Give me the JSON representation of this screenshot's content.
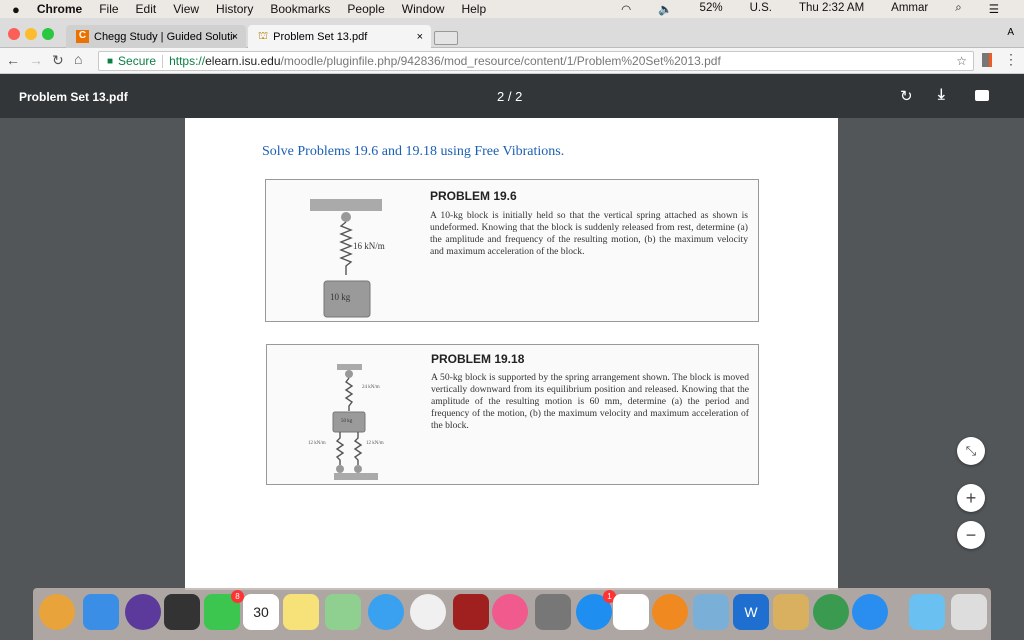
{
  "menubar": {
    "apple": "",
    "app": "Chrome",
    "items": [
      "File",
      "Edit",
      "View",
      "History",
      "Bookmarks",
      "People",
      "Window",
      "Help"
    ],
    "battery": "52%",
    "input": "U.S.",
    "clock": "Thu 2:32 AM",
    "user": "Ammar"
  },
  "tabs": [
    {
      "label": "Chegg Study | Guided Solution",
      "close": "×"
    },
    {
      "label": "Problem Set 13.pdf",
      "close": "×",
      "active": true
    }
  ],
  "profile_letter": "A",
  "address": {
    "secure": "Secure",
    "url_scheme": "https://",
    "url_host": "elearn.isu.edu",
    "url_path": "/moodle/pluginfile.php/942836/mod_resource/content/1/Problem%20Set%2013.pdf"
  },
  "pdf": {
    "title": "Problem Set 13.pdf",
    "page": "2 / 2"
  },
  "doc": {
    "heading": "Solve Problems 19.6 and 19.18 using Free Vibrations.",
    "p1": {
      "title": "PROBLEM 19.6",
      "text": "A 10-kg block is initially held so that the vertical spring attached as shown is undeformed. Knowing that the block is suddenly released from rest, determine (a) the amplitude and frequency of the resulting motion, (b) the maximum velocity and maximum acceleration of the block.",
      "spring": "16 kN/m",
      "mass": "10 kg"
    },
    "p2": {
      "title": "PROBLEM 19.18",
      "text": "A 50-kg block is supported by the spring arrangement shown. The block is moved vertically downward from its equilibrium position and released. Knowing that the amplitude of the resulting motion is 60 mm, determine (a) the period and frequency of the motion, (b) the maximum velocity and maximum acceleration of the block.",
      "spring_top": "24 kN/m",
      "mass": "50 kg",
      "spring_left": "12 kN/m",
      "spring_right": "12 kN/m"
    }
  },
  "zoom": {
    "fit": "⤡",
    "plus": "+",
    "minus": "−"
  },
  "dock": [
    {
      "name": "chrome-canary",
      "color": "#e8a33a"
    },
    {
      "name": "finder",
      "color": "#3a8ee6"
    },
    {
      "name": "siri",
      "color": "#5b3a9b"
    },
    {
      "name": "mission-control",
      "color": "#333"
    },
    {
      "name": "facetime",
      "color": "#3cc650",
      "badge": "8"
    },
    {
      "name": "calendar",
      "color": "#fff",
      "text": "30"
    },
    {
      "name": "notes",
      "color": "#f7e27a"
    },
    {
      "name": "maps",
      "color": "#8fcf8f"
    },
    {
      "name": "messages",
      "color": "#3aa0f0"
    },
    {
      "name": "photos",
      "color": "#f0f0f0"
    },
    {
      "name": "photo-booth",
      "color": "#a02020"
    },
    {
      "name": "itunes",
      "color": "#f05a8c"
    },
    {
      "name": "system-preferences",
      "color": "#777"
    },
    {
      "name": "app-store",
      "color": "#1e8ef0",
      "badge": "1"
    },
    {
      "name": "reminders",
      "color": "#fff"
    },
    {
      "name": "ibooks",
      "color": "#f08a20"
    },
    {
      "name": "preview",
      "color": "#7ab0d8"
    },
    {
      "name": "word",
      "color": "#1e6fd0",
      "text": "W"
    },
    {
      "name": "archive-utility",
      "color": "#d8b060"
    },
    {
      "name": "chrome",
      "color": "#3a9a50"
    },
    {
      "name": "safari",
      "color": "#2a8ef0"
    },
    {
      "name": "downloads",
      "color": "#6ac0f0"
    },
    {
      "name": "trash",
      "color": "#ddd"
    }
  ]
}
